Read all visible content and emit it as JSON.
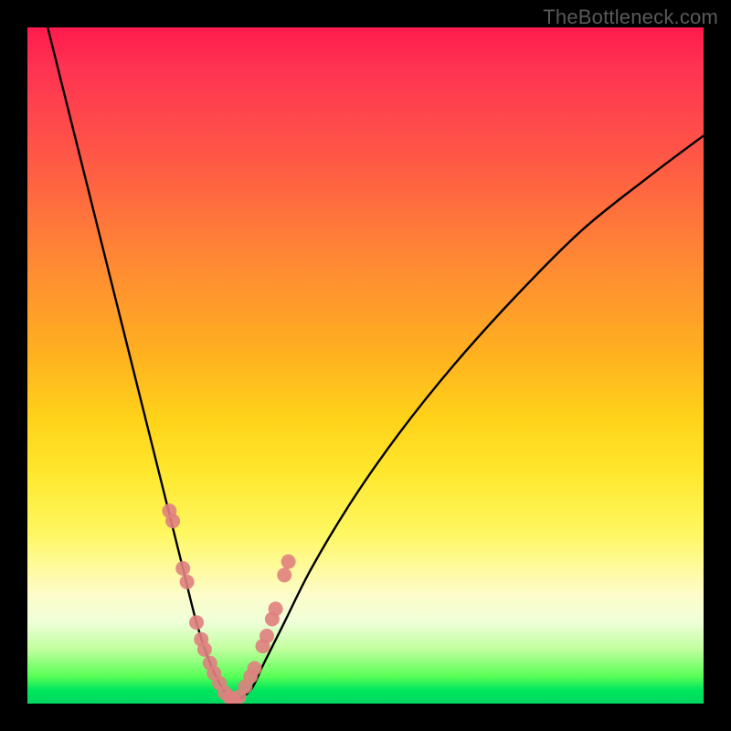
{
  "watermark": "TheBottleneck.com",
  "chart_data": {
    "type": "line",
    "title": "",
    "xlabel": "",
    "ylabel": "",
    "xlim": [
      0,
      100
    ],
    "ylim": [
      0,
      100
    ],
    "series": [
      {
        "name": "bottleneck-curve",
        "x": [
          3,
          5,
          7,
          9,
          11,
          13,
          15,
          17,
          19,
          21,
          23,
          25,
          27,
          29,
          30.5,
          33,
          35,
          38,
          42,
          48,
          55,
          63,
          72,
          82,
          92,
          100
        ],
        "values": [
          100,
          92,
          84,
          76,
          68,
          60,
          52,
          44,
          36,
          28,
          20,
          12,
          6,
          2,
          0.5,
          2,
          6,
          12,
          20,
          30,
          40,
          50,
          60,
          70,
          78,
          84
        ]
      }
    ],
    "markers": {
      "name": "highlight-dots",
      "color": "#e08080",
      "x": [
        21.0,
        21.5,
        23.0,
        23.6,
        25.0,
        25.7,
        26.2,
        27.0,
        27.6,
        28.4,
        29.2,
        29.9,
        30.5,
        31.3,
        32.2,
        33.0,
        33.6,
        34.8,
        35.4,
        36.2,
        36.7,
        38.0,
        38.6
      ],
      "values": [
        28.5,
        27.0,
        20.0,
        18.0,
        12.0,
        9.5,
        8.0,
        6.0,
        4.5,
        3.0,
        1.6,
        0.9,
        0.5,
        1.0,
        2.5,
        4.0,
        5.2,
        8.5,
        10.0,
        12.5,
        14.0,
        19.0,
        21.0
      ]
    },
    "gradient_stops": [
      {
        "pos": 0.0,
        "color": "#ff1a4d"
      },
      {
        "pos": 0.35,
        "color": "#ff8a33"
      },
      {
        "pos": 0.66,
        "color": "#ffe82e"
      },
      {
        "pos": 0.88,
        "color": "#efffd8"
      },
      {
        "pos": 0.98,
        "color": "#00e65c"
      }
    ]
  },
  "colors": {
    "curve": "#000000",
    "marker": "#e08080",
    "frame": "#000000"
  }
}
